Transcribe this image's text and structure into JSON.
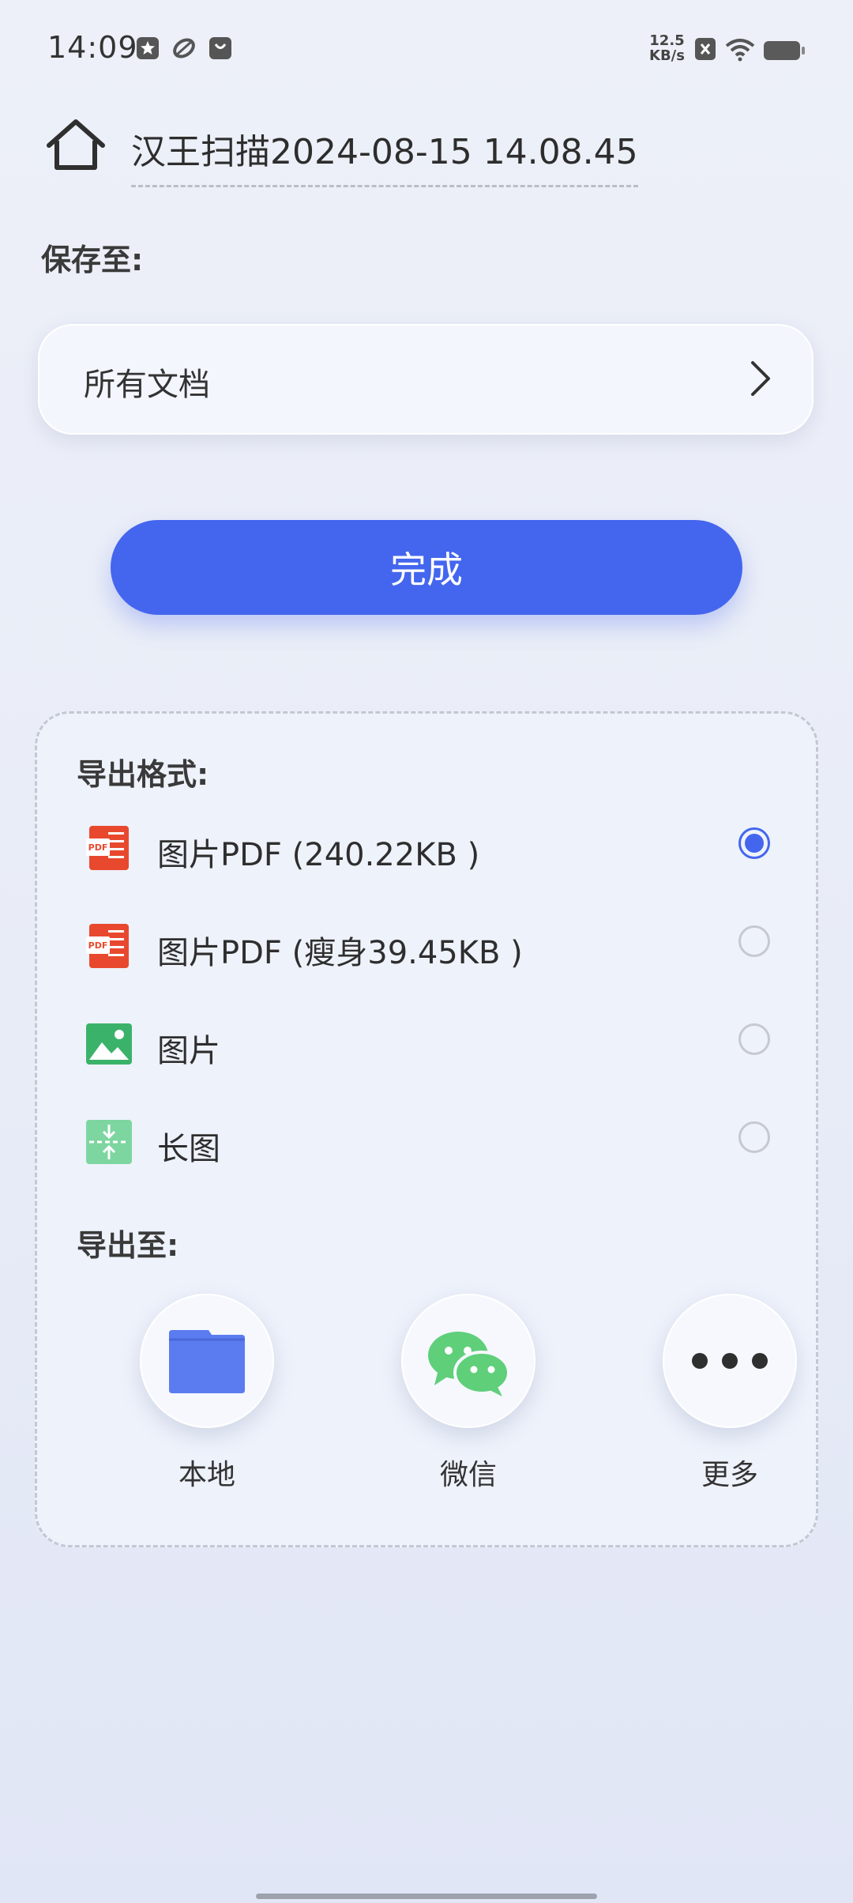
{
  "status_bar": {
    "time": "14:09",
    "net_speed_value": "12.5",
    "net_speed_unit": "KB/s",
    "icons": [
      "star-app-icon",
      "leaf-app-icon",
      "shop-bag-icon",
      "close-box-icon",
      "wifi-icon",
      "battery-icon"
    ]
  },
  "header": {
    "home_icon": "home-icon",
    "document_title": "汉王扫描2024-08-15 14.08.45"
  },
  "save": {
    "label": "保存至:",
    "folder": "所有文档"
  },
  "done_button": "完成",
  "export_format": {
    "label": "导出格式:",
    "options": [
      {
        "label": "图片PDF (240.22KB )",
        "icon": "pdf-icon",
        "selected": true
      },
      {
        "label": "图片PDF (瘦身39.45KB )",
        "icon": "pdf-icon",
        "selected": false
      },
      {
        "label": "图片",
        "icon": "image-icon",
        "selected": false
      },
      {
        "label": "长图",
        "icon": "long-image-icon",
        "selected": false
      }
    ]
  },
  "export_to": {
    "label": "导出至:",
    "destinations": [
      {
        "label": "本地",
        "icon": "folder-icon"
      },
      {
        "label": "微信",
        "icon": "wechat-icon"
      },
      {
        "label": "更多",
        "icon": "more-icon"
      }
    ]
  },
  "colors": {
    "accent": "#4466ee",
    "pdf_red": "#e8492e",
    "image_green": "#3bb26a",
    "long_image_green": "#7dd6a0",
    "wechat_green": "#5fcf7a",
    "folder_blue": "#5b7cf0"
  }
}
